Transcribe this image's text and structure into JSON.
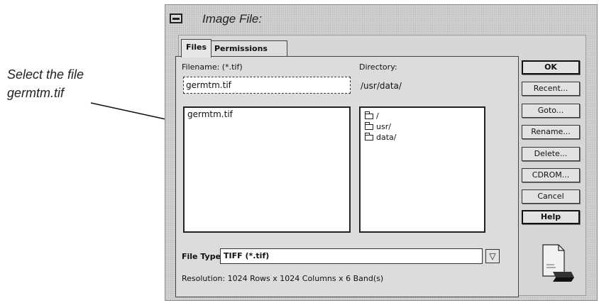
{
  "annotation": {
    "lines": [
      "Select the file",
      "germtm.tif"
    ]
  },
  "dialog": {
    "title": "Image File:",
    "tabs": [
      {
        "label": "Files"
      },
      {
        "label": "Permissions"
      }
    ],
    "filename_label": "Filename: (*.tif)",
    "filename_value": "germtm.tif",
    "directory_label": "Directory:",
    "directory_value": "/usr/data/",
    "files": [
      "germtm.tif"
    ],
    "directories": [
      "/",
      "usr/",
      "data/"
    ],
    "filetype_label": "File Type:",
    "filetype_value": "TIFF (*.tif)",
    "resolution_text": "Resolution: 1024 Rows x 1024 Columns x 6 Band(s)",
    "buttons": {
      "ok": "OK",
      "recent": "Recent...",
      "goto": "Goto...",
      "rename": "Rename...",
      "delete": "Delete...",
      "cdrom": "CDROM...",
      "cancel": "Cancel",
      "help": "Help"
    }
  }
}
